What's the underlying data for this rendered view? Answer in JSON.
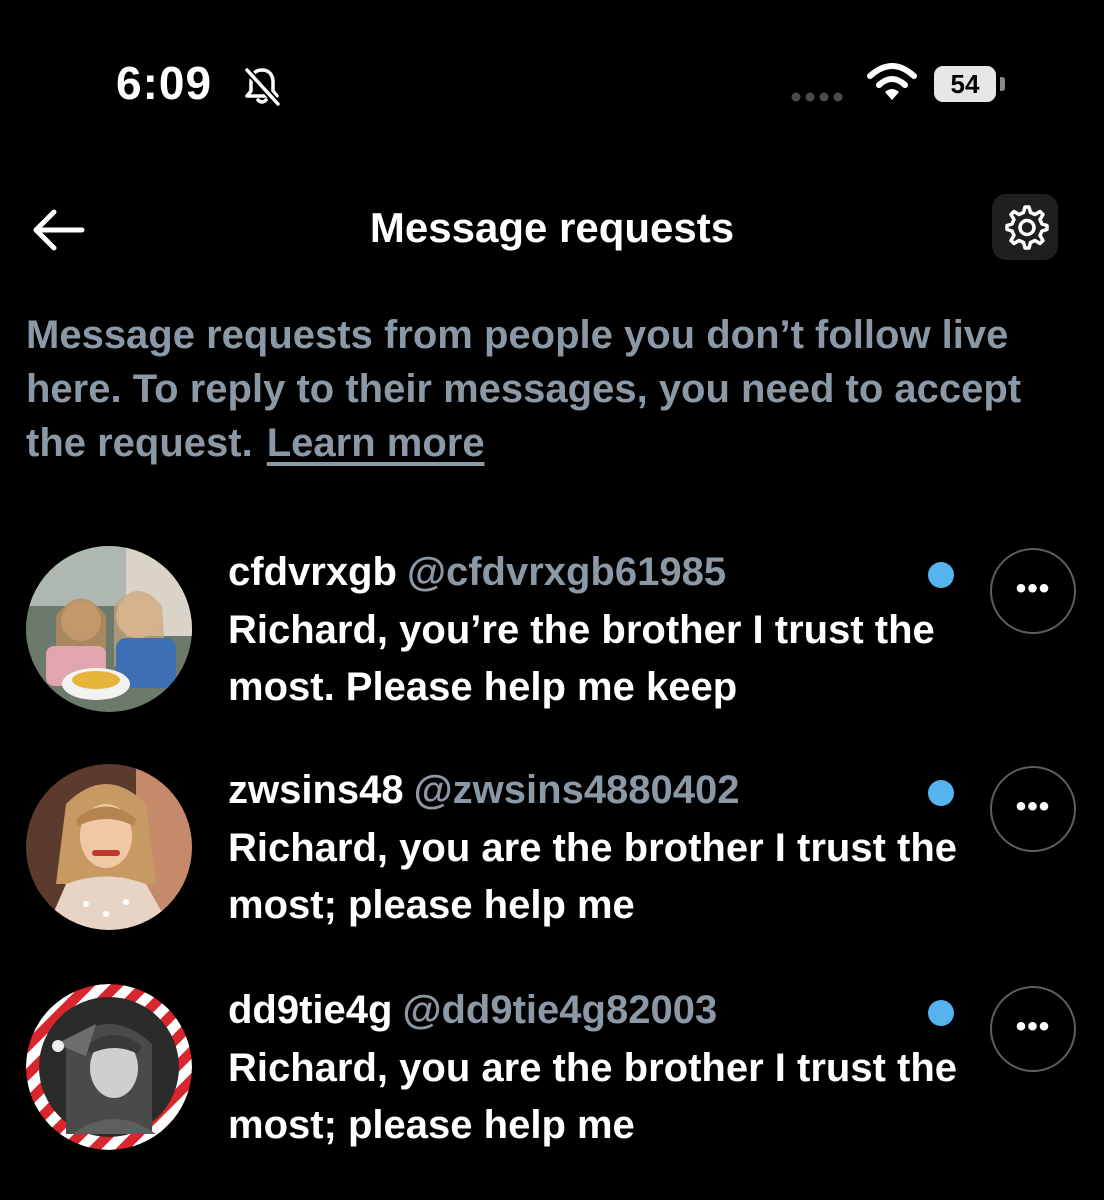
{
  "status_bar": {
    "time": "6:09",
    "battery": "54",
    "icons": [
      "bell-slash-icon",
      "signal-icon",
      "wifi-icon",
      "battery-icon"
    ]
  },
  "header": {
    "title": "Message requests",
    "back_icon": "arrow-left-icon",
    "settings_icon": "gear-icon"
  },
  "description": {
    "text": "Message requests from people you don’t follow live here. To reply to their messages, you need to accept the request.",
    "link": "Learn more"
  },
  "requests": [
    {
      "display_name": "cfdvrxgb",
      "handle": "@cfdvrxgb61985",
      "preview": "Richard, you’re the brother I trust the  most. Please help me keep",
      "unread": true
    },
    {
      "display_name": "zwsins48",
      "handle": "@zwsins4880402",
      "preview": "Richard, you are the brother I trust the most; please help me",
      "unread": true
    },
    {
      "display_name": "dd9tie4g",
      "handle": "@dd9tie4g82003",
      "preview": "Richard, you are the brother I trust the most; please help me",
      "unread": true
    }
  ],
  "colors": {
    "background": "#000000",
    "text_primary": "#ffffff",
    "text_secondary": "#8b98a5",
    "unread_dot": "#55b4ee"
  }
}
